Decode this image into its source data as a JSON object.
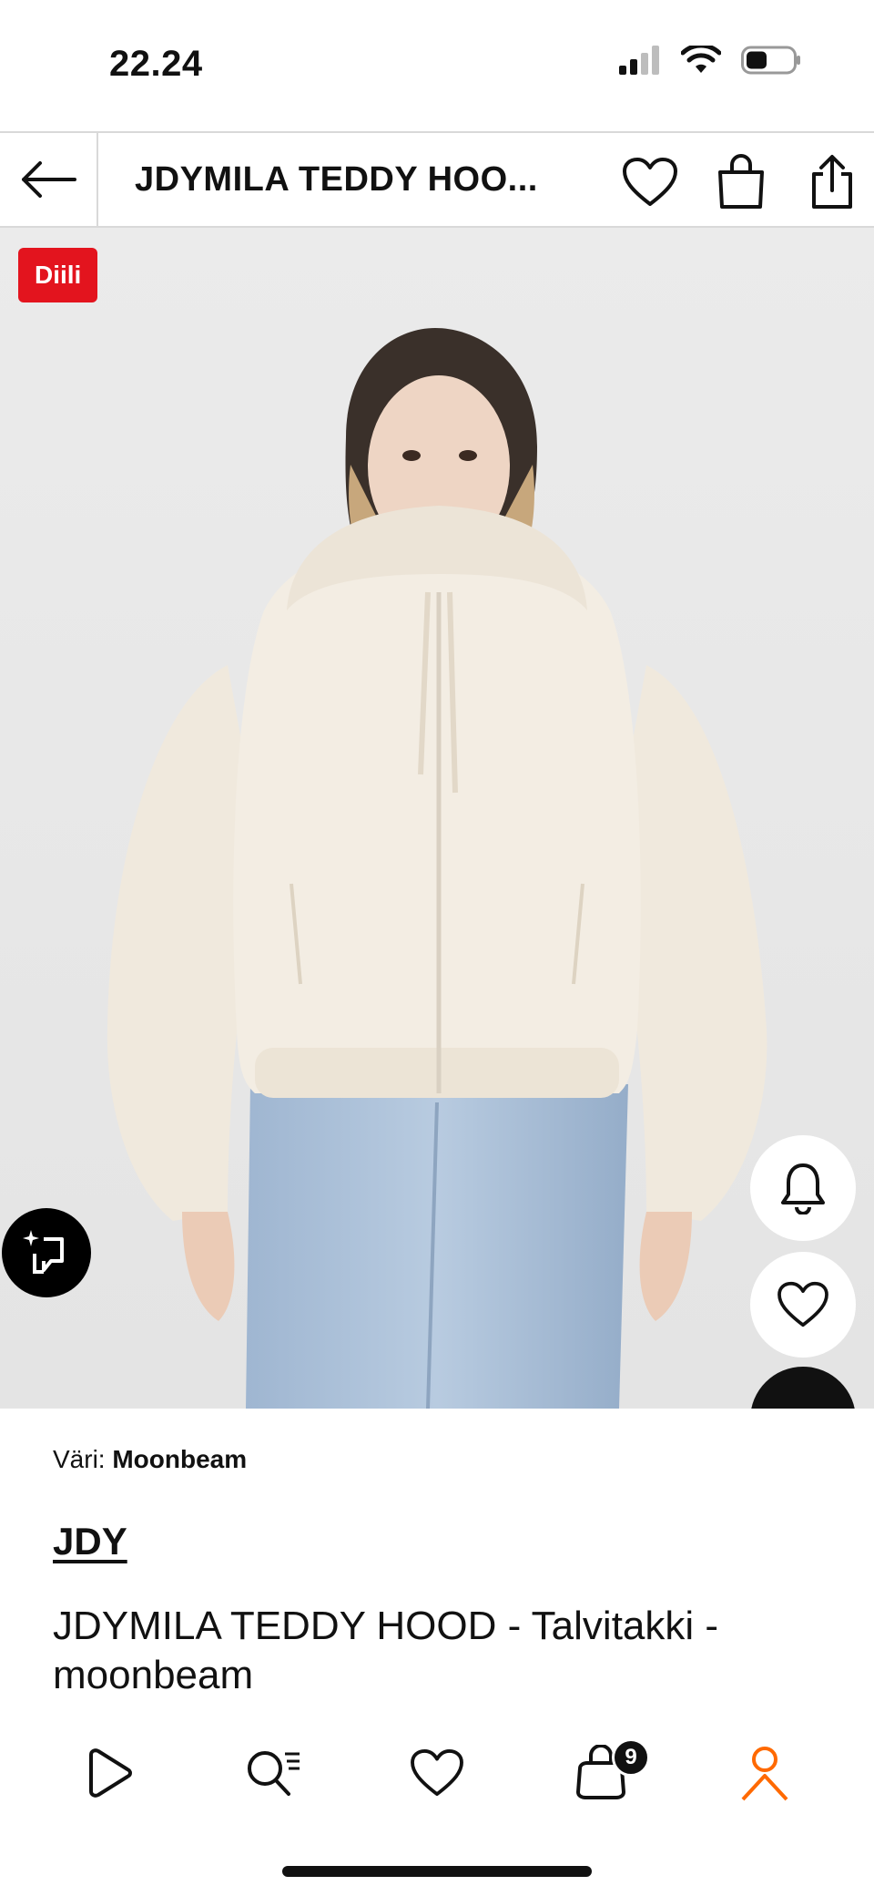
{
  "status_bar": {
    "time": "22.24"
  },
  "header": {
    "title": "JDYMILA TEDDY HOO...",
    "icons": [
      "back-arrow-icon",
      "heart-icon",
      "shopping-bag-icon",
      "share-icon"
    ]
  },
  "hero": {
    "badge": "Diili",
    "badge_color": "#e3141e",
    "image_description_icon": "product-photo",
    "floating_buttons": [
      "bell-icon",
      "heart-icon",
      "ai-search-icon"
    ]
  },
  "details": {
    "color_label": "Väri:",
    "color_value": "Moonbeam",
    "brand": "JDY",
    "title": "JDYMILA TEDDY HOOD - Talvitakki - moonbeam"
  },
  "bottom_nav": {
    "items": [
      "play-icon",
      "search-icon",
      "heart-icon",
      "bag-icon",
      "profile-icon"
    ],
    "cart_count": "9",
    "active_color": "#ff6900"
  }
}
